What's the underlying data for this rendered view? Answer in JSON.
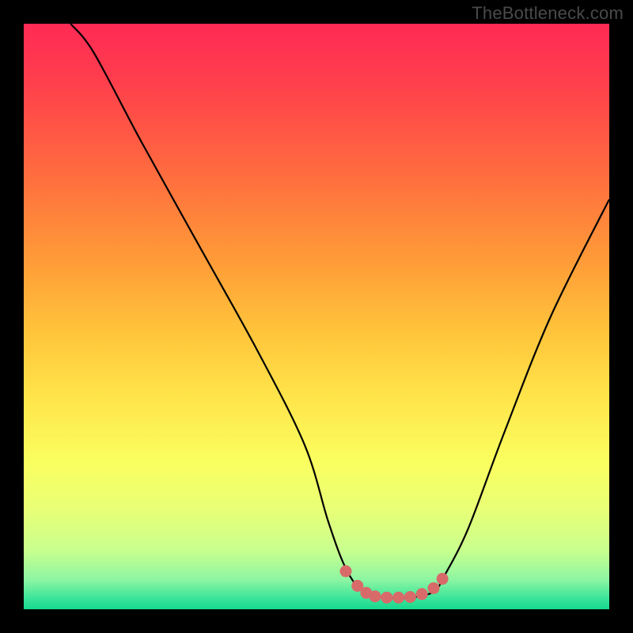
{
  "watermark": "TheBottleneck.com",
  "chart_data": {
    "type": "line",
    "title": "",
    "xlabel": "",
    "ylabel": "",
    "ylim": [
      0,
      100
    ],
    "xlim": [
      0,
      100
    ],
    "series": [
      {
        "name": "bottleneck-curve",
        "x": [
          8,
          12,
          20,
          30,
          40,
          48,
          52,
          55,
          58,
          62,
          66,
          70,
          72,
          76,
          82,
          90,
          100
        ],
        "values": [
          100,
          95,
          80,
          62,
          44,
          28,
          15,
          7,
          3,
          2,
          2,
          3,
          6,
          14,
          30,
          50,
          70
        ]
      }
    ],
    "markers": {
      "name": "highlight-dots",
      "color": "#d96a6a",
      "x": [
        55,
        57,
        58.5,
        60,
        62,
        64,
        66,
        68,
        70,
        71.5
      ],
      "values": [
        6.5,
        4,
        2.8,
        2.2,
        2,
        2,
        2.1,
        2.6,
        3.6,
        5.2
      ]
    }
  }
}
